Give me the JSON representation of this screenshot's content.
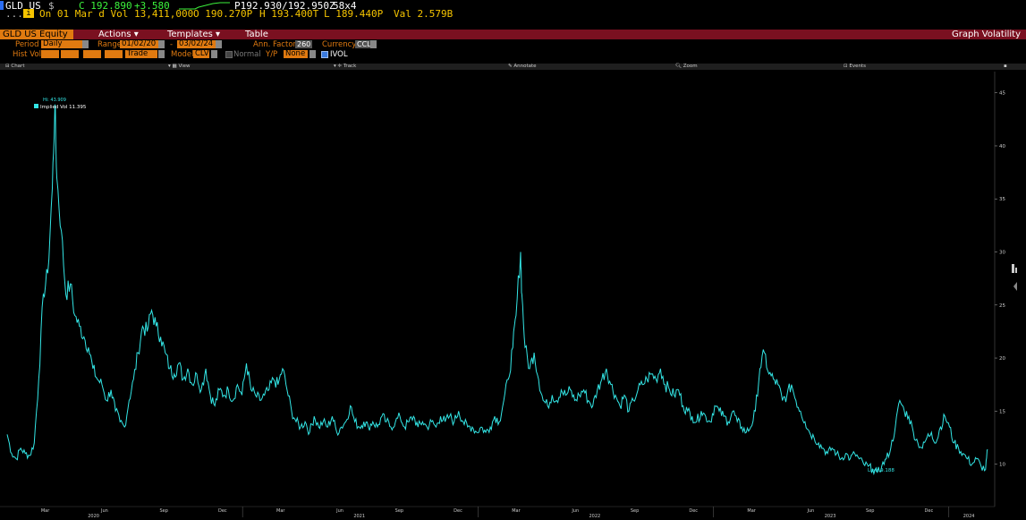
{
  "quote": {
    "ticker": "GLD US",
    "currency_sym": "$",
    "last": "C 192.890",
    "change": "+3.580",
    "bid_ask": "P192.930/192.950Z",
    "size": "58x4",
    "more": "...",
    "date_line": "On 01 Mar d Vol 13,411,000",
    "open": "O 190.270P",
    "high": "H 193.400T",
    "low": "L 189.440P",
    "val": "Val 2.579B"
  },
  "menu": {
    "security": "GLD US Equity",
    "actions": "Actions",
    "templates": "Templates",
    "table": "Table",
    "title": "Graph Volatility"
  },
  "controls": {
    "period_label": "Period",
    "period_value": "Daily",
    "range_label": "Range",
    "range_start": "01/02/20",
    "range_sep": "-",
    "range_end": "03/02/24",
    "ann_factor_label": "Ann. Factor",
    "ann_factor_value": "260",
    "currency_label": "Currency",
    "currency_value": "CCL",
    "hist_vol_label": "Hist Vol",
    "trade_value": "Trade",
    "model_label": "Model",
    "model_value": "CLV",
    "normal_label": "Normal",
    "yp_label": "Y/P",
    "yp_value": "None",
    "ivol_label": "IVOL"
  },
  "toolbar": {
    "chart": "Chart",
    "view": "View",
    "track": "Track",
    "annotate": "Annotate",
    "zoom": "Zoom",
    "events": "Events"
  },
  "colors": {
    "background": "#000000",
    "line": "#33e6e6",
    "menubar": "#7a1020",
    "accent_orange": "#e07a10"
  },
  "chart_data": {
    "type": "line",
    "title": "",
    "xlabel": "",
    "ylabel": "",
    "ylim": [
      6,
      47
    ],
    "y_ticks": [
      10,
      15,
      20,
      25,
      30,
      35,
      40,
      45
    ],
    "x_tick_labels": [
      "Mar",
      "Jun",
      "Sep",
      "Dec",
      "Mar",
      "Jun",
      "Sep",
      "Dec",
      "Mar",
      "Jun",
      "Sep",
      "Dec",
      "Mar",
      "Jun",
      "Sep",
      "Dec"
    ],
    "year_labels": [
      "2020",
      "2021",
      "2022",
      "2023",
      "2024"
    ],
    "legend": {
      "position": "top-left",
      "label": "Implied Vol 11.395"
    },
    "annotations": {
      "high_label": "Hi: 43.909",
      "low_label": "Low: 9.188"
    },
    "series": [
      {
        "name": "Implied Vol",
        "points": [
          [
            "2020-01-02",
            12.8
          ],
          [
            "2020-01-09",
            11.0
          ],
          [
            "2020-01-16",
            10.5
          ],
          [
            "2020-01-23",
            11.5
          ],
          [
            "2020-01-30",
            11.0
          ],
          [
            "2020-02-06",
            10.8
          ],
          [
            "2020-02-13",
            12.0
          ],
          [
            "2020-02-20",
            18.0
          ],
          [
            "2020-02-27",
            26.0
          ],
          [
            "2020-03-05",
            28.0
          ],
          [
            "2020-03-12",
            36.0
          ],
          [
            "2020-03-16",
            43.9
          ],
          [
            "2020-03-19",
            37.0
          ],
          [
            "2020-03-26",
            32.0
          ],
          [
            "2020-04-02",
            26.0
          ],
          [
            "2020-04-09",
            27.0
          ],
          [
            "2020-04-16",
            24.0
          ],
          [
            "2020-04-23",
            23.0
          ],
          [
            "2020-04-30",
            22.0
          ],
          [
            "2020-05-07",
            21.0
          ],
          [
            "2020-05-14",
            19.0
          ],
          [
            "2020-05-21",
            18.0
          ],
          [
            "2020-05-28",
            17.5
          ],
          [
            "2020-06-04",
            16.0
          ],
          [
            "2020-06-11",
            17.0
          ],
          [
            "2020-06-18",
            15.0
          ],
          [
            "2020-06-25",
            14.0
          ],
          [
            "2020-07-02",
            13.5
          ],
          [
            "2020-07-09",
            16.0
          ],
          [
            "2020-07-16",
            18.0
          ],
          [
            "2020-07-23",
            20.5
          ],
          [
            "2020-07-30",
            23.0
          ],
          [
            "2020-08-06",
            22.5
          ],
          [
            "2020-08-13",
            24.5
          ],
          [
            "2020-08-20",
            23.0
          ],
          [
            "2020-08-27",
            22.0
          ],
          [
            "2020-09-03",
            20.5
          ],
          [
            "2020-09-10",
            19.0
          ],
          [
            "2020-09-17",
            18.5
          ],
          [
            "2020-09-24",
            19.5
          ],
          [
            "2020-10-01",
            18.0
          ],
          [
            "2020-10-08",
            19.0
          ],
          [
            "2020-10-15",
            17.5
          ],
          [
            "2020-10-22",
            18.5
          ],
          [
            "2020-10-29",
            17.0
          ],
          [
            "2020-11-05",
            19.0
          ],
          [
            "2020-11-12",
            16.5
          ],
          [
            "2020-11-19",
            15.5
          ],
          [
            "2020-11-26",
            17.0
          ],
          [
            "2020-12-03",
            16.5
          ],
          [
            "2020-12-10",
            17.0
          ],
          [
            "2020-12-17",
            16.0
          ],
          [
            "2020-12-24",
            17.5
          ],
          [
            "2020-12-31",
            16.5
          ],
          [
            "2021-01-07",
            19.5
          ],
          [
            "2021-01-14",
            17.0
          ],
          [
            "2021-01-21",
            16.5
          ],
          [
            "2021-01-28",
            16.0
          ],
          [
            "2021-02-04",
            16.5
          ],
          [
            "2021-02-11",
            17.0
          ],
          [
            "2021-02-18",
            18.0
          ],
          [
            "2021-02-25",
            17.5
          ],
          [
            "2021-03-04",
            19.0
          ],
          [
            "2021-03-11",
            17.0
          ],
          [
            "2021-03-18",
            15.0
          ],
          [
            "2021-03-25",
            14.0
          ],
          [
            "2021-04-01",
            13.5
          ],
          [
            "2021-04-08",
            14.0
          ],
          [
            "2021-04-15",
            13.0
          ],
          [
            "2021-04-22",
            14.5
          ],
          [
            "2021-04-29",
            13.5
          ],
          [
            "2021-05-06",
            14.0
          ],
          [
            "2021-05-13",
            13.5
          ],
          [
            "2021-05-20",
            14.5
          ],
          [
            "2021-05-27",
            13.0
          ],
          [
            "2021-06-03",
            13.5
          ],
          [
            "2021-06-10",
            14.0
          ],
          [
            "2021-06-17",
            15.5
          ],
          [
            "2021-06-24",
            14.0
          ],
          [
            "2021-07-01",
            13.5
          ],
          [
            "2021-07-08",
            14.0
          ],
          [
            "2021-07-15",
            13.5
          ],
          [
            "2021-07-22",
            14.0
          ],
          [
            "2021-07-29",
            13.5
          ],
          [
            "2021-08-05",
            14.5
          ],
          [
            "2021-08-12",
            14.0
          ],
          [
            "2021-08-19",
            13.5
          ],
          [
            "2021-08-26",
            14.0
          ],
          [
            "2021-09-02",
            14.5
          ],
          [
            "2021-09-09",
            13.5
          ],
          [
            "2021-09-16",
            14.0
          ],
          [
            "2021-09-23",
            14.5
          ],
          [
            "2021-09-30",
            13.5
          ],
          [
            "2021-10-07",
            14.0
          ],
          [
            "2021-10-14",
            13.5
          ],
          [
            "2021-10-21",
            14.0
          ],
          [
            "2021-10-28",
            13.5
          ],
          [
            "2021-11-04",
            14.5
          ],
          [
            "2021-11-11",
            14.0
          ],
          [
            "2021-11-18",
            14.5
          ],
          [
            "2021-11-25",
            14.0
          ],
          [
            "2021-12-02",
            15.0
          ],
          [
            "2021-12-09",
            14.0
          ],
          [
            "2021-12-16",
            13.5
          ],
          [
            "2021-12-23",
            13.5
          ],
          [
            "2021-12-30",
            13.0
          ],
          [
            "2022-01-06",
            13.5
          ],
          [
            "2022-01-13",
            13.0
          ],
          [
            "2022-01-20",
            13.5
          ],
          [
            "2022-01-27",
            14.5
          ],
          [
            "2022-02-03",
            14.0
          ],
          [
            "2022-02-10",
            16.0
          ],
          [
            "2022-02-17",
            18.0
          ],
          [
            "2022-02-24",
            21.0
          ],
          [
            "2022-03-01",
            24.0
          ],
          [
            "2022-03-08",
            30.0
          ],
          [
            "2022-03-10",
            26.0
          ],
          [
            "2022-03-15",
            21.0
          ],
          [
            "2022-03-22",
            19.0
          ],
          [
            "2022-03-29",
            20.5
          ],
          [
            "2022-04-05",
            18.0
          ],
          [
            "2022-04-12",
            16.0
          ],
          [
            "2022-04-19",
            15.5
          ],
          [
            "2022-04-26",
            16.5
          ],
          [
            "2022-05-03",
            16.0
          ],
          [
            "2022-05-10",
            17.0
          ],
          [
            "2022-05-17",
            16.5
          ],
          [
            "2022-05-24",
            17.0
          ],
          [
            "2022-05-31",
            16.0
          ],
          [
            "2022-06-07",
            16.5
          ],
          [
            "2022-06-14",
            17.0
          ],
          [
            "2022-06-21",
            16.0
          ],
          [
            "2022-06-28",
            15.5
          ],
          [
            "2022-07-05",
            17.0
          ],
          [
            "2022-07-12",
            18.0
          ],
          [
            "2022-07-19",
            19.0
          ],
          [
            "2022-07-26",
            17.5
          ],
          [
            "2022-08-02",
            16.5
          ],
          [
            "2022-08-09",
            15.5
          ],
          [
            "2022-08-16",
            16.5
          ],
          [
            "2022-08-23",
            15.0
          ],
          [
            "2022-08-30",
            16.0
          ],
          [
            "2022-09-06",
            17.0
          ],
          [
            "2022-09-13",
            17.5
          ],
          [
            "2022-09-20",
            18.0
          ],
          [
            "2022-09-27",
            18.5
          ],
          [
            "2022-10-04",
            18.0
          ],
          [
            "2022-10-11",
            19.0
          ],
          [
            "2022-10-18",
            17.5
          ],
          [
            "2022-10-25",
            17.0
          ],
          [
            "2022-11-01",
            16.5
          ],
          [
            "2022-11-08",
            17.0
          ],
          [
            "2022-11-15",
            15.5
          ],
          [
            "2022-11-22",
            15.0
          ],
          [
            "2022-11-29",
            14.5
          ],
          [
            "2022-12-06",
            14.0
          ],
          [
            "2022-12-13",
            15.0
          ],
          [
            "2022-12-20",
            14.5
          ],
          [
            "2022-12-27",
            14.0
          ],
          [
            "2023-01-03",
            15.5
          ],
          [
            "2023-01-10",
            15.0
          ],
          [
            "2023-01-17",
            14.5
          ],
          [
            "2023-01-24",
            14.0
          ],
          [
            "2023-01-31",
            15.0
          ],
          [
            "2023-02-07",
            14.0
          ],
          [
            "2023-02-14",
            13.5
          ],
          [
            "2023-02-21",
            13.0
          ],
          [
            "2023-02-28",
            13.5
          ],
          [
            "2023-03-07",
            15.0
          ],
          [
            "2023-03-14",
            19.0
          ],
          [
            "2023-03-21",
            20.5
          ],
          [
            "2023-03-28",
            18.5
          ],
          [
            "2023-04-04",
            18.0
          ],
          [
            "2023-04-11",
            17.5
          ],
          [
            "2023-04-18",
            16.0
          ],
          [
            "2023-04-25",
            16.5
          ],
          [
            "2023-05-02",
            17.5
          ],
          [
            "2023-05-09",
            16.0
          ],
          [
            "2023-05-16",
            15.0
          ],
          [
            "2023-05-23",
            14.0
          ],
          [
            "2023-05-30",
            13.0
          ],
          [
            "2023-06-06",
            12.5
          ],
          [
            "2023-06-13",
            12.0
          ],
          [
            "2023-06-20",
            11.5
          ],
          [
            "2023-06-27",
            11.0
          ],
          [
            "2023-07-04",
            11.5
          ],
          [
            "2023-07-11",
            11.0
          ],
          [
            "2023-07-18",
            10.5
          ],
          [
            "2023-07-25",
            11.0
          ],
          [
            "2023-08-01",
            10.5
          ],
          [
            "2023-08-08",
            11.0
          ],
          [
            "2023-08-15",
            10.5
          ],
          [
            "2023-08-22",
            10.0
          ],
          [
            "2023-08-29",
            9.8
          ],
          [
            "2023-09-05",
            9.5
          ],
          [
            "2023-09-12",
            9.188
          ],
          [
            "2023-09-19",
            9.8
          ],
          [
            "2023-09-26",
            10.5
          ],
          [
            "2023-10-03",
            11.5
          ],
          [
            "2023-10-10",
            13.5
          ],
          [
            "2023-10-17",
            16.0
          ],
          [
            "2023-10-24",
            15.0
          ],
          [
            "2023-10-31",
            14.5
          ],
          [
            "2023-11-07",
            13.0
          ],
          [
            "2023-11-14",
            12.0
          ],
          [
            "2023-11-21",
            11.5
          ],
          [
            "2023-11-28",
            12.5
          ],
          [
            "2023-12-05",
            13.0
          ],
          [
            "2023-12-12",
            12.0
          ],
          [
            "2023-12-19",
            13.5
          ],
          [
            "2023-12-26",
            14.5
          ],
          [
            "2024-01-02",
            13.5
          ],
          [
            "2024-01-09",
            12.0
          ],
          [
            "2024-01-16",
            11.5
          ],
          [
            "2024-01-23",
            11.0
          ],
          [
            "2024-01-30",
            10.5
          ],
          [
            "2024-02-06",
            10.0
          ],
          [
            "2024-02-13",
            10.5
          ],
          [
            "2024-02-20",
            9.8
          ],
          [
            "2024-02-27",
            9.5
          ],
          [
            "2024-03-01",
            11.395
          ]
        ]
      }
    ]
  }
}
